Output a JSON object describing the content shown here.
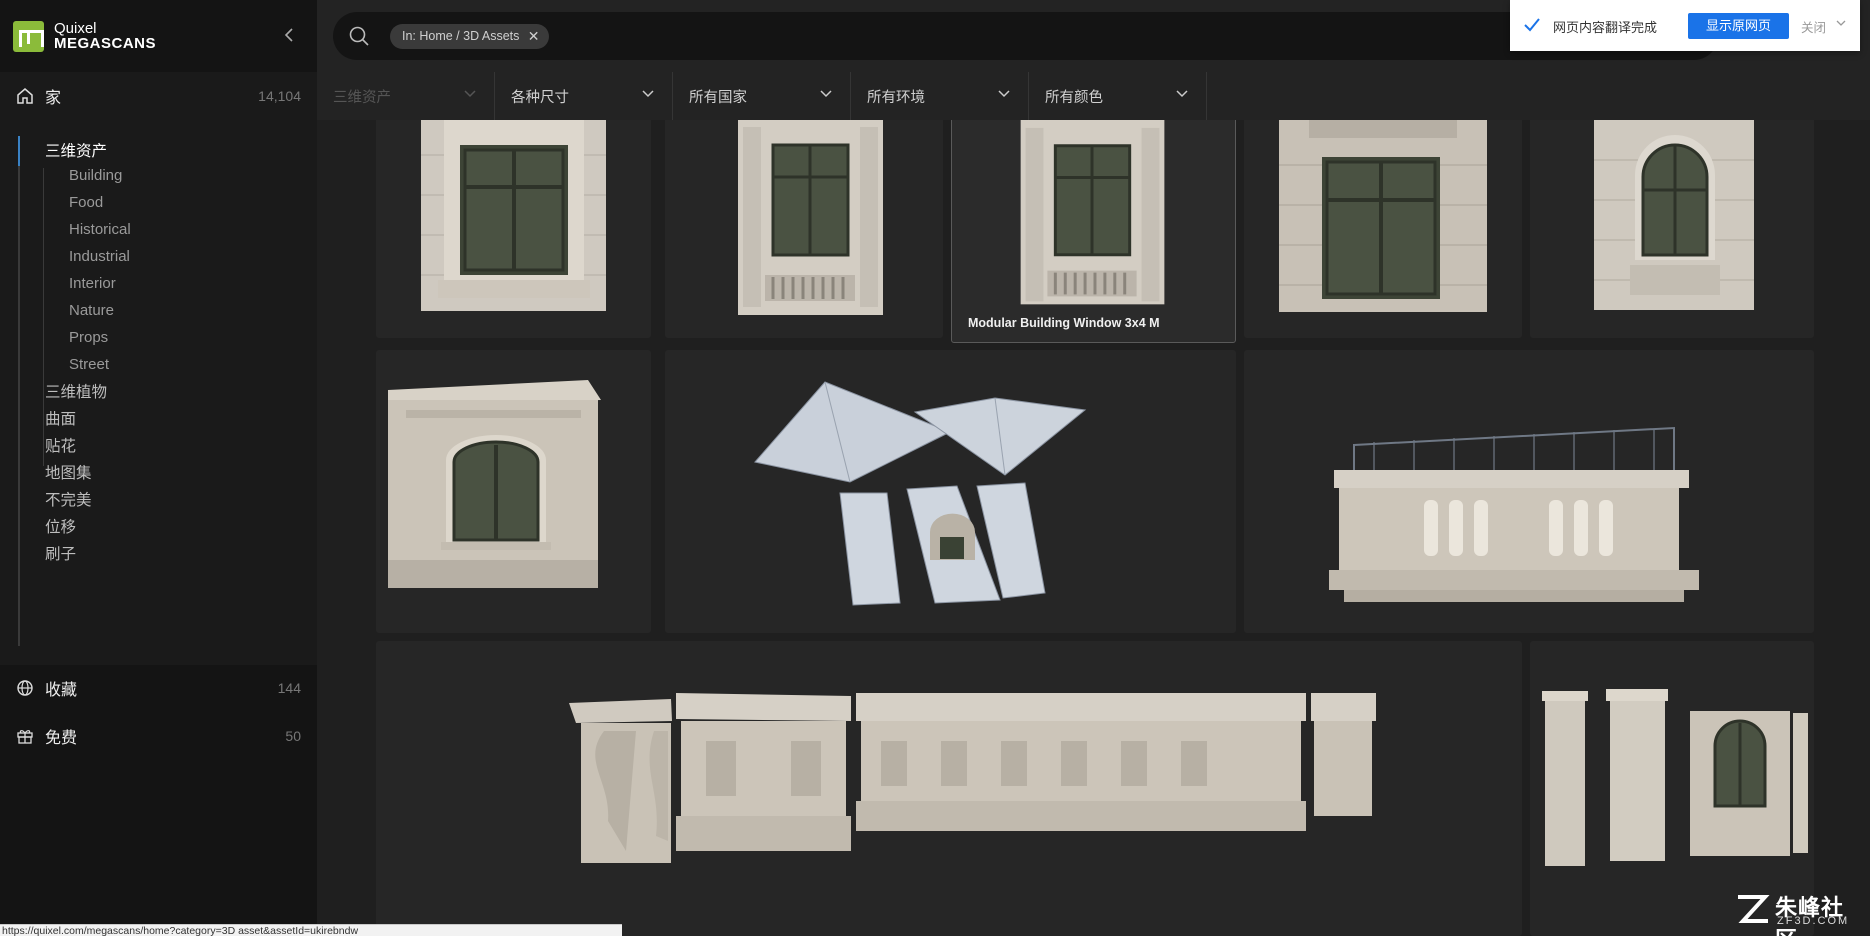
{
  "brand": {
    "top": "Quixel",
    "bottom": "MEGASCANS"
  },
  "nav": {
    "home": {
      "label": "家",
      "count": "14,104"
    },
    "favorites": {
      "label": "收藏",
      "count": "144"
    },
    "free": {
      "label": "免费",
      "count": "50"
    }
  },
  "tree": {
    "active": "三维资产",
    "subitems": [
      "Building",
      "Food",
      "Historical",
      "Industrial",
      "Interior",
      "Nature",
      "Props",
      "Street"
    ],
    "others": [
      "三维植物",
      "曲面",
      "贴花",
      "地图集",
      "不完美",
      "位移",
      "刷子"
    ]
  },
  "search": {
    "chip": "In: Home / 3D Assets"
  },
  "filters": [
    {
      "label": "三维资产",
      "disabled": true
    },
    {
      "label": "各种尺寸"
    },
    {
      "label": "所有国家"
    },
    {
      "label": "所有环境"
    },
    {
      "label": "所有颜色"
    }
  ],
  "translate": {
    "message": "网页内容翻译完成",
    "show_original": "显示原网页",
    "close": "关闭"
  },
  "cards": {
    "selected_title": "Modular Building Window 3x4 M"
  },
  "statusbar": {
    "url": "https://quixel.com/megascans/home?category=3D asset&assetId=ukirebndw"
  },
  "watermark": {
    "cn": "朱峰社区",
    "en": "ZF3D.COM"
  },
  "colors": {
    "accent": "#3a82c4",
    "brand": "#8bbb3a",
    "translate_button": "#1a73e8"
  }
}
